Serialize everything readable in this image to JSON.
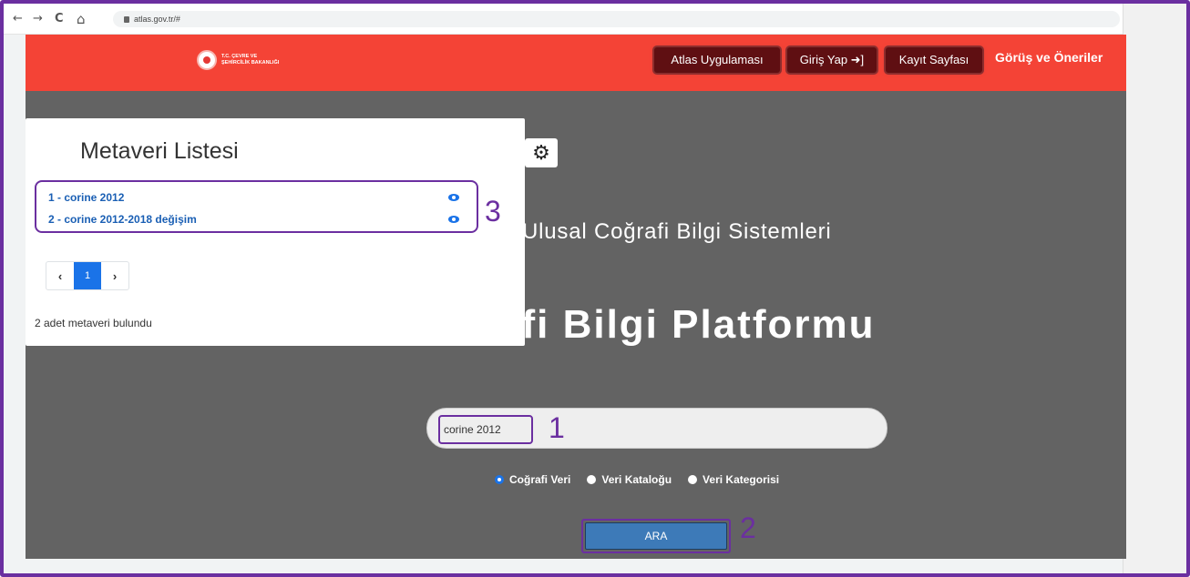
{
  "browser": {
    "back_icon": "←",
    "forward_icon": "→",
    "reload_icon": "C",
    "home_icon": "⌂",
    "url": "atlas.gov.tr/#"
  },
  "header": {
    "logo_text_line1": "T.C. ÇEVRE VE",
    "logo_text_line2": "ŞEHİRCİLİK BAKANLIĞI",
    "nav": [
      {
        "label": "Atlas Uygulaması"
      },
      {
        "label": "Giriş Yap ➜]"
      },
      {
        "label": "Kayıt Sayfası"
      }
    ],
    "feedback_label": "Görüş ve Öneriler",
    "color": "#f44336"
  },
  "hero": {
    "subtitle": "Ulusal Coğrafi Bilgi Sistemleri",
    "title": "ğrafi Bilgi Platformu",
    "search_value": "corine 2012",
    "radios": [
      {
        "label": "Coğrafi Veri",
        "selected": true
      },
      {
        "label": "Veri Kataloğu",
        "selected": false
      },
      {
        "label": "Veri Kategorisi",
        "selected": false
      }
    ],
    "search_button": "ARA"
  },
  "annotations": {
    "step1": "1",
    "step2": "2",
    "step3": "3",
    "color": "#6b2fa0"
  },
  "meta_panel": {
    "title": "Metaveri Listesi",
    "items": [
      {
        "label": "1 - corine 2012"
      },
      {
        "label": "2 - corine 2012-2018 değişim"
      }
    ],
    "pager": {
      "prev": "‹",
      "page": "1",
      "next": "›"
    },
    "count_text": "2 adet metaveri bulundu"
  }
}
